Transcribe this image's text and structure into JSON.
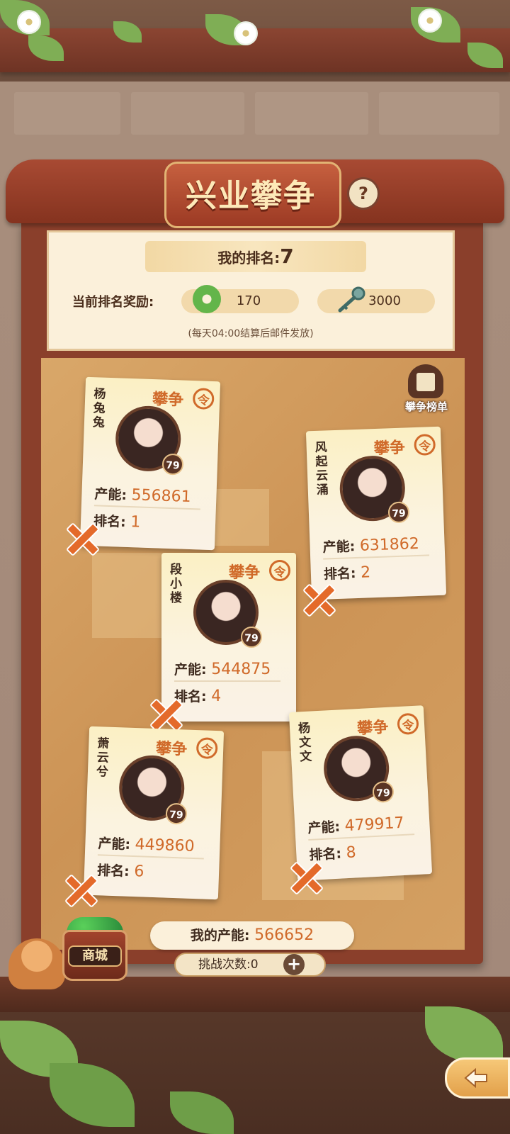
{
  "header": {
    "title": "兴业攀争",
    "help_icon": "?"
  },
  "summary": {
    "my_rank_label": "我的排名:",
    "my_rank_value": "7",
    "reward_label": "当前排名奖励:",
    "rewards": [
      {
        "icon": "jade-coin-icon",
        "amount": "170"
      },
      {
        "icon": "key-icon",
        "amount": "3000"
      }
    ],
    "note": "(每天04:00结算后邮件发放)"
  },
  "leaderboard_button": {
    "label": "攀争榜单",
    "icon": "scroll-list-icon"
  },
  "card_common": {
    "tag": "攀争",
    "stamp": "令",
    "power_label": "产能:",
    "rank_label": "排名:"
  },
  "opponents": [
    {
      "name": "杨兔兔",
      "level": "79",
      "power": "556861",
      "rank": "1"
    },
    {
      "name": "风起云涌",
      "level": "79",
      "power": "631862",
      "rank": "2"
    },
    {
      "name": "段小楼",
      "level": "79",
      "power": "544875",
      "rank": "4"
    },
    {
      "name": "萧云兮",
      "level": "79",
      "power": "449860",
      "rank": "6"
    },
    {
      "name": "杨文文",
      "level": "79",
      "power": "479917",
      "rank": "8"
    }
  ],
  "footer": {
    "my_power_label": "我的产能:",
    "my_power_value": "566652",
    "challenge_label": "挑战次数:0",
    "plus": "+",
    "shop_label": "商城"
  },
  "colors": {
    "accent": "#d06a2a",
    "frame": "#8a3f2b",
    "paper": "#fbf0da"
  }
}
